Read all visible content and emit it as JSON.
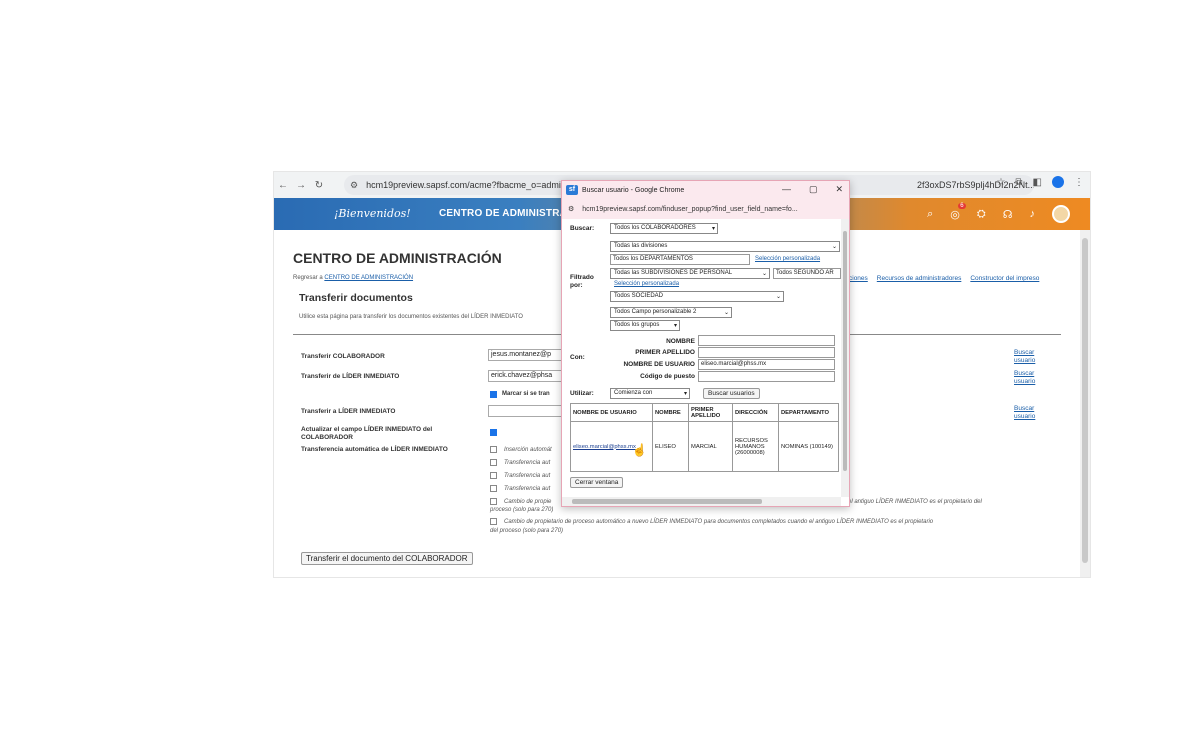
{
  "browser": {
    "url": "hcm19preview.sapsf.com/acme?fbacme_o=admin&p",
    "url_tail": "2f3oxDS7rbS9plj4hDI2n2Nt..."
  },
  "header": {
    "welcome": "¡Bienvenidos!",
    "title": "CENTRO DE ADMINISTRAC",
    "badge_count": "6"
  },
  "page": {
    "title": "CENTRO DE ADMINISTRACIÓN",
    "back_prefix": "Regresar a",
    "back_link": "CENTRO DE ADMINISTRACIÓN",
    "top_links": [
      "ciones",
      "Recursos de administradores",
      "Constructor del impreso"
    ],
    "subtitle": "Transferir documentos",
    "description": "Utilice esta página para transferir los documentos existentes del LÍDER INMEDIATO",
    "form": {
      "transfer_colaborador_label": "Transferir COLABORADOR",
      "transfer_colaborador_value": "jesus.montanez@p",
      "transfer_de_label": "Transferir de LÍDER INMEDIATO",
      "transfer_de_value": "erick.chavez@phsa",
      "marcar_label": "Marcar si se tran",
      "transfer_a_label": "Transferir a LÍDER INMEDIATO",
      "transfer_a_value": "",
      "actualizar_label": "Actualizar el campo LÍDER INMEDIATO del COLABORADOR",
      "auto_label": "Transferencia automática de LÍDER INMEDIATO",
      "options": [
        "Inserción automát",
        "Transferencia aut",
        "Transferencia aut",
        "Transferencia aut",
        "Cambio de propie",
        "Cambio de propietario de proceso automático a nuevo LÍDER INMEDIATO para documentos completados cuando el antiguo LÍDER INMEDIATO es el propietario"
      ],
      "option5_tail": "el antiguo LÍDER INMEDIATO es el propietario del",
      "option5_line2": "proceso (solo para 270)",
      "option6_line2": "del proceso (solo para 270)",
      "buscar_usuario": "Buscar usuario",
      "submit": "Transferir el documento del COLABORADOR"
    }
  },
  "popup": {
    "title": "Buscar usuario - Google Chrome",
    "url": "hcm19preview.sapsf.com/finduser_popup?find_user_field_name=fo...",
    "buscar_label": "Buscar:",
    "buscar_value": "Todos los COLABORADORES",
    "filtrado_label": "Filtrado por:",
    "filters": {
      "divisiones": "Todas las divisiones",
      "departamentos": "Todos los DEPARTAMENTOS",
      "seleccion1": "Selección personalizada",
      "subdivisiones": "Todas las SUBDIVISIONES DE PERSONAL",
      "segundo": "Todos SEGUNDO AR",
      "seleccion2": "Selección personalizada",
      "sociedad": "Todos SOCIEDAD",
      "campo": "Todos Campo personalizable 2",
      "grupos": "Todos los grupos"
    },
    "con_label": "Con:",
    "fields": {
      "nombre_label": "NOMBRE",
      "nombre_value": "",
      "apellido_label": "PRIMER APELLIDO",
      "apellido_value": "",
      "usuario_label": "NOMBRE DE USUARIO",
      "usuario_value": "eliseo.marcial@phss.mx",
      "codigo_label": "Código de puesto",
      "codigo_value": ""
    },
    "utilizar_label": "Utilizar:",
    "utilizar_value": "Comienza con",
    "buscar_btn": "Buscar usuarios",
    "table": {
      "headers": [
        "NOMBRE DE USUARIO",
        "NOMBRE",
        "PRIMER APELLIDO",
        "DIRECCIÓN",
        "DEPARTAMENTO"
      ],
      "row": [
        "eliseo.marcial@phss.mx",
        "ELISEO",
        "MARCIAL",
        "RECURSOS HUMANOS (26000008)",
        "NOMINAS (100149)"
      ]
    },
    "close_btn": "Cerrar ventana"
  }
}
